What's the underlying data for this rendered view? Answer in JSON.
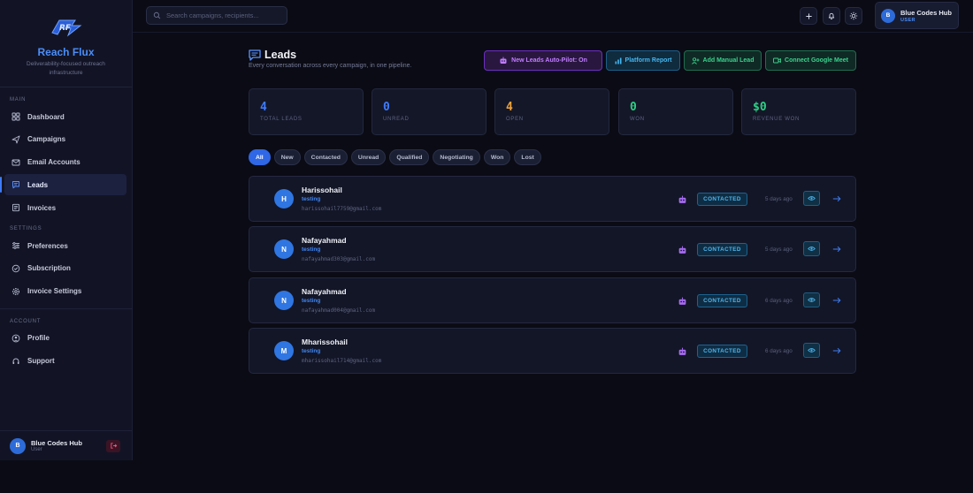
{
  "brand": {
    "name": "Reach Flux",
    "subtitle": "Deliverability-focused outreach infrastructure"
  },
  "sidebar": {
    "sections": [
      {
        "title": "MAIN",
        "items": [
          {
            "label": "Dashboard",
            "icon": "dashboard-icon"
          },
          {
            "label": "Campaigns",
            "icon": "send-icon"
          },
          {
            "label": "Email Accounts",
            "icon": "mail-icon"
          },
          {
            "label": "Leads",
            "icon": "chat-icon",
            "active": true
          },
          {
            "label": "Invoices",
            "icon": "invoice-icon"
          }
        ]
      },
      {
        "title": "SETTINGS",
        "items": [
          {
            "label": "Preferences",
            "icon": "sliders-icon"
          },
          {
            "label": "Subscription",
            "icon": "check-circle-icon"
          },
          {
            "label": "Invoice Settings",
            "icon": "gear-icon"
          }
        ]
      },
      {
        "title": "ACCOUNT",
        "items": [
          {
            "label": "Profile",
            "icon": "user-icon"
          },
          {
            "label": "Support",
            "icon": "headset-icon"
          }
        ]
      }
    ],
    "footer": {
      "initial": "B",
      "name": "Blue Codes Hub",
      "role": "User"
    }
  },
  "topbar": {
    "search_placeholder": "Search campaigns, recipients...",
    "user": {
      "initial": "B",
      "name": "Blue Codes Hub",
      "role": "USER"
    }
  },
  "page": {
    "title": "Leads",
    "subtitle": "Every conversation across every campaign, in one pipeline.",
    "buttons": {
      "autopilot": "New Leads Auto-Pilot: On",
      "report": "Platform Report",
      "manual": "Add Manual Lead",
      "meet": "Connect Google Meet"
    }
  },
  "stats": [
    {
      "value": "4",
      "label": "TOTAL LEADS",
      "color": "#3d7bff"
    },
    {
      "value": "0",
      "label": "UNREAD",
      "color": "#3d7bff"
    },
    {
      "value": "4",
      "label": "OPEN",
      "color": "#f0a23a"
    },
    {
      "value": "0",
      "label": "WON",
      "color": "#2fcf86"
    },
    {
      "value": "$0",
      "label": "REVENUE WON",
      "color": "#2fcf86"
    }
  ],
  "filters": [
    "All",
    "New",
    "Contacted",
    "Unread",
    "Qualified",
    "Negotiating",
    "Won",
    "Lost"
  ],
  "leads": [
    {
      "initial": "H",
      "name": "Harissohail",
      "campaign": "testing",
      "email": "harissohail7759@gmail.com",
      "status": "CONTACTED",
      "time": "5 days ago"
    },
    {
      "initial": "N",
      "name": "Nafayahmad",
      "campaign": "testing",
      "email": "nafayahmad303@gmail.com",
      "status": "CONTACTED",
      "time": "5 days ago"
    },
    {
      "initial": "N",
      "name": "Nafayahmad",
      "campaign": "testing",
      "email": "nafayahmad004@gmail.com",
      "status": "CONTACTED",
      "time": "6 days ago"
    },
    {
      "initial": "M",
      "name": "Mharissohail",
      "campaign": "testing",
      "email": "mharissohail714@gmail.com",
      "status": "CONTACTED",
      "time": "6 days ago"
    }
  ]
}
